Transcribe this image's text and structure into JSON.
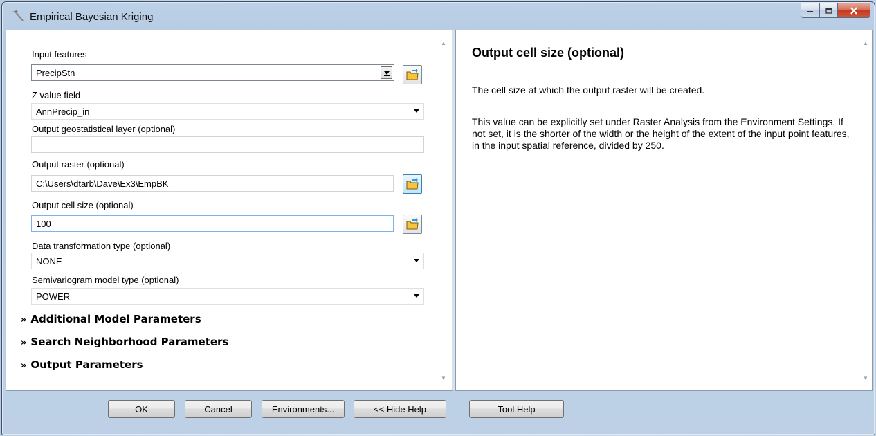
{
  "window": {
    "title": "Empirical Bayesian Kriging",
    "controls": [
      "minimize",
      "maximize",
      "close"
    ]
  },
  "params": {
    "input_features": {
      "label": "Input features",
      "value": "PrecipStn"
    },
    "z_value_field": {
      "label": "Z value field",
      "value": "AnnPrecip_in"
    },
    "output_geostat_layer": {
      "label": "Output geostatistical layer (optional)",
      "value": ""
    },
    "output_raster": {
      "label": "Output raster (optional)",
      "value": "C:\\Users\\dtarb\\Dave\\Ex3\\EmpBK"
    },
    "output_cell_size": {
      "label": "Output cell size (optional)",
      "value": "100"
    },
    "data_transformation": {
      "label": "Data transformation type (optional)",
      "value": "NONE"
    },
    "semivariogram_model": {
      "label": "Semivariogram model type (optional)",
      "value": "POWER"
    }
  },
  "sections": {
    "additional_model": "Additional Model Parameters",
    "search_neighborhood": "Search Neighborhood Parameters",
    "output": "Output Parameters"
  },
  "help": {
    "title": "Output cell size (optional)",
    "p1": "The cell size at which the output raster will be created.",
    "p2": "This value can be explicitly set under Raster Analysis from the Environment Settings. If not set, it is the shorter of the width or the height of the extent of the input point features, in the input spatial reference, divided by 250."
  },
  "buttons": {
    "ok": "OK",
    "cancel": "Cancel",
    "environments": "Environments...",
    "hide_help": "<< Hide Help",
    "tool_help": "Tool Help"
  }
}
